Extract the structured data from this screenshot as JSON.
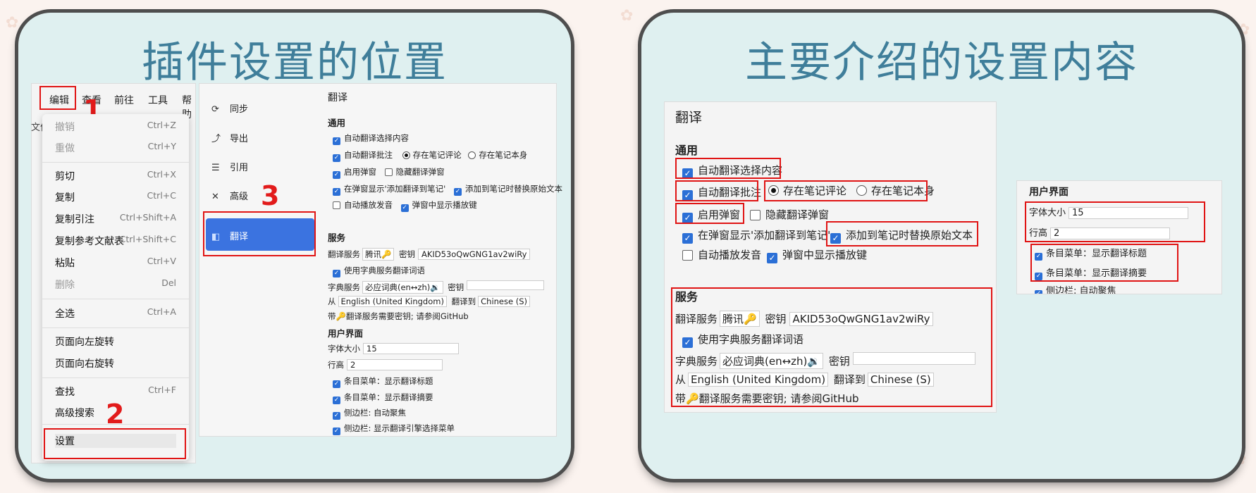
{
  "left": {
    "title": "插件设置的位置",
    "menubar": [
      "编辑",
      "查看",
      "前往",
      "工具",
      "帮助"
    ],
    "menu_items": [
      {
        "label": "撤销",
        "shortcut": "Ctrl+Z",
        "disabled": true
      },
      {
        "label": "重做",
        "shortcut": "Ctrl+Y",
        "disabled": true
      },
      {
        "label": "剪切",
        "shortcut": "Ctrl+X",
        "disabled": false
      },
      {
        "label": "复制",
        "shortcut": "Ctrl+C",
        "disabled": false
      },
      {
        "label": "复制引注",
        "shortcut": "Ctrl+Shift+A",
        "disabled": false
      },
      {
        "label": "复制参考文献表",
        "shortcut": "Ctrl+Shift+C",
        "disabled": false
      },
      {
        "label": "粘贴",
        "shortcut": "Ctrl+V",
        "disabled": false
      },
      {
        "label": "删除",
        "shortcut": "Del",
        "disabled": true
      },
      {
        "label": "全选",
        "shortcut": "Ctrl+A",
        "disabled": false
      },
      {
        "label": "页面向左旋转",
        "shortcut": "",
        "disabled": false
      },
      {
        "label": "页面向右旋转",
        "shortcut": "",
        "disabled": false
      },
      {
        "label": "查找",
        "shortcut": "Ctrl+F",
        "disabled": false
      },
      {
        "label": "高级搜索",
        "shortcut": "",
        "disabled": false
      },
      {
        "label": "设置",
        "shortcut": "",
        "disabled": false
      }
    ],
    "nav": [
      {
        "label": "同步",
        "icon": "sync-icon",
        "glyph": "⟳"
      },
      {
        "label": "导出",
        "icon": "export-icon",
        "glyph": "⤴"
      },
      {
        "label": "引用",
        "icon": "cite-icon",
        "glyph": "☰"
      },
      {
        "label": "高级",
        "icon": "tools-icon",
        "glyph": "✕"
      },
      {
        "label": "翻译",
        "icon": "translate-icon",
        "glyph": "◧"
      }
    ],
    "callouts": [
      "1",
      "2",
      "3"
    ],
    "settings": {
      "section_title": "翻译",
      "general_header": "通用",
      "auto_translate_selection": "自动翻译选择内容",
      "auto_translate_annotation": "自动翻译批注",
      "save_in_comment": "存在笔记评论",
      "save_in_body": "存在笔记本身",
      "enable_popup": "启用弹窗",
      "hide_popup": "隐藏翻译弹窗",
      "show_add_to_note": "在弹窗显示'添加翻译到笔记'",
      "replace_original": "添加到笔记时替换原始文本",
      "auto_play_audio": "自动播放发音",
      "show_play_button": "弹窗中显示播放键",
      "service_header": "服务",
      "translate_service_label": "翻译服务",
      "translate_service_value": "腾讯🔑",
      "secret_label": "密钥",
      "secret_value": "AKID53oQwGNG1av2wiRy",
      "use_dict": "使用字典服务翻译词语",
      "dict_service_label": "字典服务",
      "dict_service_value": "必应词典(en↔zh)🔉",
      "from_label": "从",
      "from_value": "English (United Kingdom)",
      "to_label": "翻译到",
      "to_value": "Chinese (S)",
      "note": "带🔑翻译服务需要密钥; 请参阅GitHub",
      "ui_header": "用户界面",
      "font_size_label": "字体大小",
      "font_size_value": "15",
      "line_height_label": "行高",
      "line_height_value": "2",
      "item_menu_title": "条目菜单：显示翻译标题",
      "item_menu_abstract": "条目菜单：显示翻译摘要",
      "sidebar_focus": "侧边栏: 自动聚焦",
      "sidebar_engine": "侧边栏: 显示翻译引擎选择菜单"
    }
  },
  "right": {
    "title": "主要介绍的设置内容",
    "section_title": "翻译",
    "general_header": "通用",
    "auto_translate_selection": "自动翻译选择内容",
    "auto_translate_annotation": "自动翻译批注",
    "save_in_comment": "存在笔记评论",
    "save_in_body": "存在笔记本身",
    "enable_popup": "启用弹窗",
    "hide_popup": "隐藏翻译弹窗",
    "show_add_to_note": "在弹窗显示'添加翻译到笔记'",
    "replace_original": "添加到笔记时替换原始文本",
    "auto_play_audio": "自动播放发音",
    "show_play_button": "弹窗中显示播放键",
    "service_header": "服务",
    "translate_service_label": "翻译服务",
    "translate_service_value": "腾讯🔑",
    "secret_label": "密钥",
    "secret_value": "AKID53oQwGNG1av2wiRy",
    "use_dict": "使用字典服务翻译词语",
    "dict_service_label": "字典服务",
    "dict_service_value": "必应词典(en↔zh)🔉",
    "from_label": "从",
    "from_value": "English (United Kingdom)",
    "to_label": "翻译到",
    "to_value": "Chinese (S)",
    "note": "带🔑翻译服务需要密钥; 请参阅GitHub",
    "ui_header": "用户界面",
    "font_size_label": "字体大小",
    "font_size_value": "15",
    "line_height_label": "行高",
    "line_height_value": "2",
    "item_menu_title": "条目菜单：显示翻译标题",
    "item_menu_abstract": "条目菜单：显示翻译摘要",
    "sidebar_focus": "侧边栏: 自动聚焦"
  },
  "colors": {
    "card_bg": "#dff0f0",
    "title": "#3f7e9a",
    "highlight": "#e01414",
    "nav_active": "#3b73e0",
    "checkbox": "#2b6fd6"
  }
}
